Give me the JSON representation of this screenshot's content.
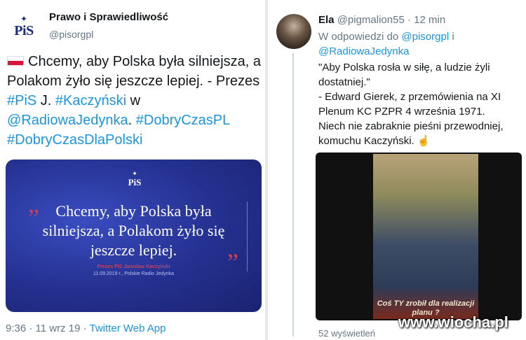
{
  "left_tweet": {
    "author_name": "Prawo i Sprawiedliwość",
    "author_handle": "@pisorgpl",
    "logo_text": "PiS",
    "text_part1": "Chcemy, aby Polska była silniejsza, a Polakom żyło się jeszcze lepiej. - Prezes ",
    "tag_pis": "#PiS",
    "text_part2": " J. ",
    "tag_kaczynski": "#Kaczyński",
    "text_part3": " w ",
    "mention_radio": "@RadiowaJedynka",
    "text_part4": ". ",
    "tag_dobry1": "#DobryCzasPL",
    "tag_dobry2": "#DobryCzasDlaPolski",
    "card": {
      "logo_text": "PiS",
      "quote": "Chcemy, aby Polska była silniejsza, a Polakom żyło się jeszcze lepiej.",
      "author": "Prezes PiS Jarosław Kaczyński",
      "date": "11.09.2019 r., Polskie Radio Jedynka",
      "open_quote": "„",
      "close_quote": "”"
    },
    "footer_time": "9:36 · 11 wrz 19 · ",
    "footer_app": "Twitter Web App"
  },
  "right_tweet": {
    "author_name": "Ela",
    "author_meta": "@pigmalion55 · 12 min",
    "reply_prefix": "W odpowiedzi do ",
    "reply_to1": "@pisorgpl",
    "reply_and": " i ",
    "reply_to2": "@RadiowaJedynka",
    "text": "\"Aby Polska rosła w siłę, a ludzie żyli dostatniej.\"\n- Edward Gierek, z przemówienia na XI Plenum KC PZPR 4 września 1971.\nNiech nie zabraknie pieśni przewodniej, komuchu Kaczyński. ☝",
    "poster_caption": "Coś TY zrobił dla realizacji planu ?",
    "views": "52 wyświetleń"
  },
  "watermark": "www.wiocha.pl"
}
